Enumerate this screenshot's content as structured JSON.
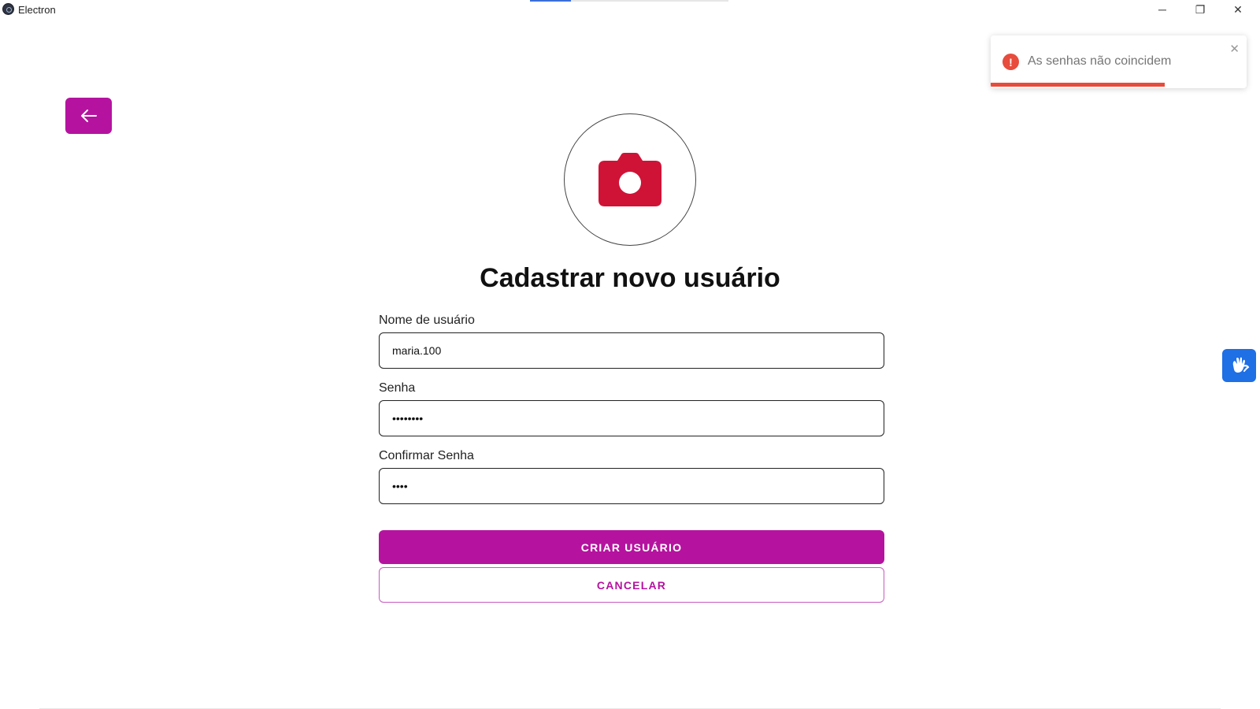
{
  "window": {
    "title": "Electron",
    "minimize_label": "─",
    "maximize_label": "❐",
    "close_label": "✕"
  },
  "header": {
    "back_icon": "arrow-left-icon"
  },
  "avatar": {
    "icon": "camera-icon"
  },
  "page": {
    "title": "Cadastrar novo usuário"
  },
  "form": {
    "username": {
      "label": "Nome de usuário",
      "value": "maria.100"
    },
    "password": {
      "label": "Senha",
      "value": "••••••••"
    },
    "confirm_password": {
      "label": "Confirmar Senha",
      "value": "••••"
    }
  },
  "actions": {
    "create_label": "CRIAR USUÁRIO",
    "cancel_label": "CANCELAR"
  },
  "toast": {
    "icon": "error-icon",
    "icon_glyph": "!",
    "message": "As senhas não coincidem",
    "close_label": "✕",
    "progress": 0.68
  },
  "accessibility": {
    "icon": "sign-language-icon"
  },
  "colors": {
    "accent": "#b5139f",
    "error": "#e74c3c",
    "camera": "#cf1337",
    "a11y": "#1f6fe5"
  }
}
